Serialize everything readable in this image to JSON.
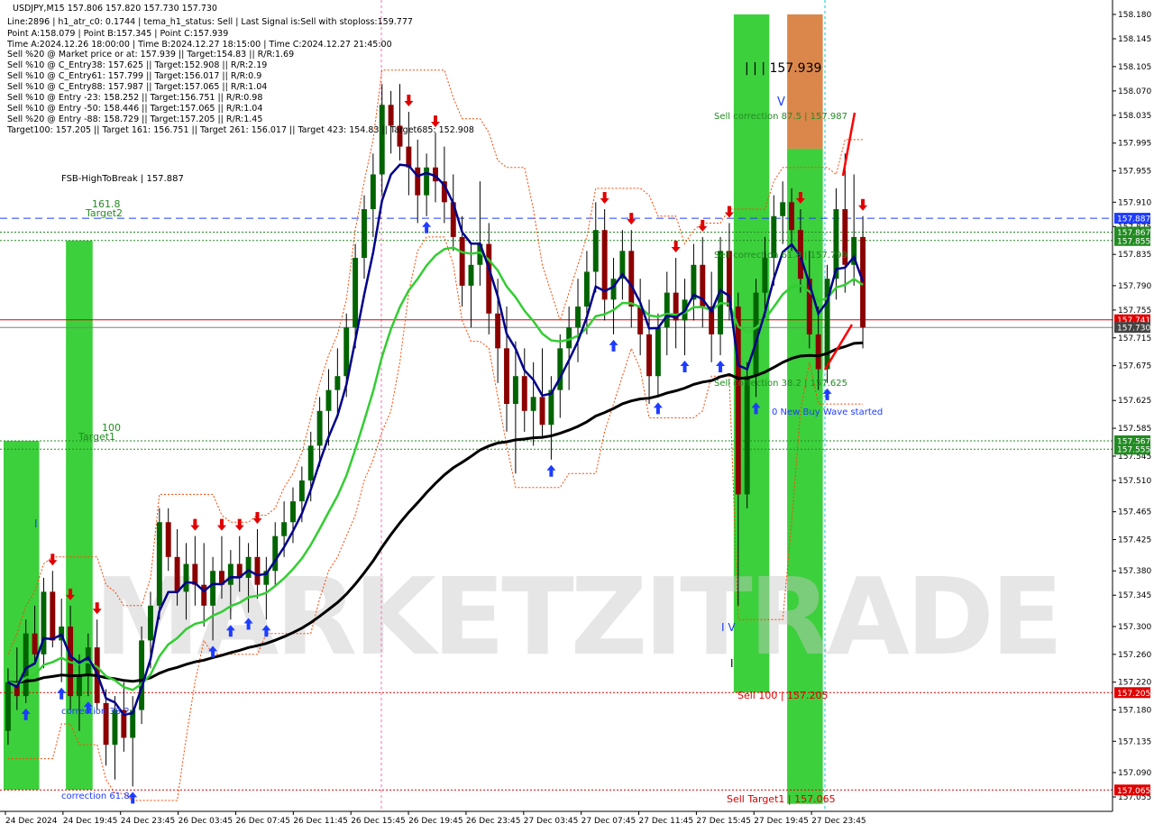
{
  "symbol_header": "USDJPY,M15  157.806 157.820 157.730 157.730",
  "info_lines": [
    "Line:2896  |  h1_atr_c0: 0.1744  |  tema_h1_status: Sell  |  Last Signal is:Sell with stoploss:159.777",
    "Point A:158.079  |  Point B:157.345  |  Point C:157.939",
    "Time A:2024.12.26 18:00:00  |  Time B:2024.12.27 18:15:00  |  Time C:2024.12.27 21:45:00",
    "Sell %20 @ Market price or at: 157.939  ||  Target:154.83  ||  R/R:1.69",
    "Sell %10 @ C_Entry38: 157.625  ||  Target:152.908  ||  R/R:2.19",
    "Sell %10 @ C_Entry61: 157.799  ||  Target:156.017  ||  R/R:0.9",
    "Sell %10 @ C_Entry88: 157.987  ||  Target:157.065  ||  R/R:1.04",
    "Sell %10 @ Entry -23: 158.252  ||  Target:156.751  ||  R/R:0.98",
    "Sell %10 @ Entry -50: 158.446  ||  Target:157.065  ||  R/R:1.04",
    "Sell %20 @ Entry -88: 158.729  ||  Target:157.205  ||  R/R:1.45",
    "Target100: 157.205  ||  Target 161: 156.751  ||  Target 261: 156.017  ||  Target 423: 154.83  ||  Target685: 152.908"
  ],
  "watermark": "MARKETZITRADE",
  "chart_labels": {
    "fsb": "FSB-HighToBreak  |  157.887",
    "target2": "Target2",
    "t161": "161.8",
    "target1": "Target1",
    "t100": "100",
    "corr382": "correction 38.2",
    "corr618": "correction 61.8",
    "point_c": "| | | 157.939",
    "sell_corr875": "Sell correction 87.5 | 157.987",
    "sell_corr618": "Sell correction 61.8 | 157.799",
    "sell_corr382": "Sell correction 38.2 | 157.625",
    "new_buy_wave": "0 New Buy Wave started",
    "sell100": "Sell 100 | 157.205",
    "sell_target1": "Sell Target1 | 157.065",
    "mark_v": "V",
    "mark_i": "I",
    "mark_iv": "I V"
  },
  "colors": {
    "bull_candle": "#006400",
    "bear_candle": "#8b0000",
    "wick": "#000000",
    "tema_line": "#00008b",
    "ema_green": "#32cd32",
    "ema_black": "#000000",
    "band_red": "#ff4500",
    "green_zone": "#32cd32",
    "orange_zone": "#d2691e",
    "fsb_line": "#1e3cff",
    "red_level": "#e00000",
    "green_level": "#228b22",
    "gray_level": "#808080"
  },
  "chart_data": {
    "type": "candlestick",
    "symbol": "USDJPY",
    "timeframe": "M15",
    "ylim": [
      157.045,
      158.185
    ],
    "y_ticks": [
      158.18,
      158.145,
      158.105,
      158.07,
      158.035,
      157.995,
      157.955,
      157.91,
      157.875,
      157.835,
      157.79,
      157.755,
      157.715,
      157.675,
      157.625,
      157.585,
      157.545,
      157.51,
      157.465,
      157.425,
      157.38,
      157.345,
      157.3,
      157.26,
      157.22,
      157.18,
      157.135,
      157.09,
      157.055
    ],
    "x_ticks": [
      "24 Dec 2024",
      "24 Dec 19:45",
      "24 Dec 23:45",
      "26 Dec 03:45",
      "26 Dec 07:45",
      "26 Dec 11:45",
      "26 Dec 15:45",
      "26 Dec 19:45",
      "26 Dec 23:45",
      "27 Dec 03:45",
      "27 Dec 07:45",
      "27 Dec 11:45",
      "27 Dec 15:45",
      "27 Dec 19:45",
      "27 Dec 23:45"
    ],
    "price_tags": [
      {
        "value": "157.887",
        "price": 157.887,
        "bg": "#1e3cff"
      },
      {
        "value": "157.867",
        "price": 157.867,
        "bg": "#228b22"
      },
      {
        "value": "157.855",
        "price": 157.855,
        "bg": "#228b22"
      },
      {
        "value": "157.741",
        "price": 157.741,
        "bg": "#e00000"
      },
      {
        "value": "157.730",
        "price": 157.73,
        "bg": "#444444"
      },
      {
        "value": "157.567",
        "price": 157.567,
        "bg": "#228b22"
      },
      {
        "value": "157.555",
        "price": 157.555,
        "bg": "#228b22"
      },
      {
        "value": "157.205",
        "price": 157.205,
        "bg": "#e00000"
      },
      {
        "value": "157.065",
        "price": 157.065,
        "bg": "#e00000"
      }
    ],
    "levels": [
      {
        "price": 157.887,
        "kind": "fsb"
      },
      {
        "price": 157.867,
        "kind": "green"
      },
      {
        "price": 157.855,
        "kind": "green"
      },
      {
        "price": 157.741,
        "kind": "red_solid"
      },
      {
        "price": 157.73,
        "kind": "gray"
      },
      {
        "price": 157.567,
        "kind": "green"
      },
      {
        "price": 157.555,
        "kind": "green"
      },
      {
        "price": 157.205,
        "kind": "red_dot"
      },
      {
        "price": 157.065,
        "kind": "red_dot"
      }
    ],
    "zones": [
      {
        "name": "Target1 zone A",
        "color": "green",
        "from": 157.567,
        "to": 157.065,
        "x0": 0,
        "x1": 4
      },
      {
        "name": "Target2 zone",
        "color": "green",
        "from": 157.855,
        "to": 157.065,
        "x0": 7,
        "x1": 10
      },
      {
        "name": "Sell zone main",
        "color": "green",
        "from": 158.18,
        "to": 157.205,
        "x0": 82,
        "x1": 86
      },
      {
        "name": "Sell Target zone",
        "color": "green",
        "from": 157.987,
        "to": 157.045,
        "x0": 88,
        "x1": 92
      },
      {
        "name": "Point C zone",
        "color": "orange",
        "from": 158.18,
        "to": 157.987,
        "x0": 88,
        "x1": 92
      }
    ],
    "candles": [
      [
        157.15,
        157.24,
        157.13,
        157.22
      ],
      [
        157.22,
        157.27,
        157.18,
        157.2
      ],
      [
        157.2,
        157.31,
        157.19,
        157.29
      ],
      [
        157.29,
        157.33,
        157.25,
        157.26
      ],
      [
        157.26,
        157.37,
        157.24,
        157.35
      ],
      [
        157.35,
        157.38,
        157.27,
        157.28
      ],
      [
        157.28,
        157.34,
        157.22,
        157.3
      ],
      [
        157.3,
        157.33,
        157.18,
        157.2
      ],
      [
        157.2,
        157.26,
        157.15,
        157.23
      ],
      [
        157.23,
        157.29,
        157.2,
        157.27
      ],
      [
        157.27,
        157.31,
        157.18,
        157.19
      ],
      [
        157.19,
        157.21,
        157.1,
        157.13
      ],
      [
        157.13,
        157.2,
        157.08,
        157.18
      ],
      [
        157.18,
        157.22,
        157.12,
        157.14
      ],
      [
        157.14,
        157.2,
        157.07,
        157.18
      ],
      [
        157.18,
        157.3,
        157.16,
        157.28
      ],
      [
        157.28,
        157.35,
        157.24,
        157.33
      ],
      [
        157.33,
        157.47,
        157.31,
        157.45
      ],
      [
        157.45,
        157.47,
        157.38,
        157.4
      ],
      [
        157.4,
        157.44,
        157.33,
        157.35
      ],
      [
        157.35,
        157.42,
        157.31,
        157.39
      ],
      [
        157.39,
        157.43,
        157.33,
        157.36
      ],
      [
        157.36,
        157.42,
        157.3,
        157.33
      ],
      [
        157.33,
        157.4,
        157.28,
        157.38
      ],
      [
        157.38,
        157.43,
        157.34,
        157.36
      ],
      [
        157.36,
        157.41,
        157.31,
        157.39
      ],
      [
        157.39,
        157.43,
        157.35,
        157.37
      ],
      [
        157.37,
        157.42,
        157.32,
        157.4
      ],
      [
        157.4,
        157.44,
        157.34,
        157.36
      ],
      [
        157.36,
        157.4,
        157.31,
        157.38
      ],
      [
        157.38,
        157.45,
        157.36,
        157.43
      ],
      [
        157.43,
        157.48,
        157.4,
        157.45
      ],
      [
        157.45,
        157.5,
        157.42,
        157.48
      ],
      [
        157.48,
        157.53,
        157.45,
        157.51
      ],
      [
        157.51,
        157.58,
        157.48,
        157.56
      ],
      [
        157.56,
        157.63,
        157.53,
        157.61
      ],
      [
        157.61,
        157.67,
        157.56,
        157.64
      ],
      [
        157.64,
        157.7,
        157.6,
        157.66
      ],
      [
        157.66,
        157.75,
        157.63,
        157.73
      ],
      [
        157.73,
        157.85,
        157.7,
        157.83
      ],
      [
        157.83,
        157.92,
        157.8,
        157.9
      ],
      [
        157.9,
        157.98,
        157.86,
        157.95
      ],
      [
        157.95,
        158.08,
        157.92,
        158.05
      ],
      [
        158.05,
        158.07,
        157.98,
        158.02
      ],
      [
        158.02,
        158.08,
        157.97,
        157.99
      ],
      [
        157.99,
        158.04,
        157.92,
        157.96
      ],
      [
        157.96,
        158.0,
        157.88,
        157.92
      ],
      [
        157.92,
        157.98,
        157.89,
        157.96
      ],
      [
        157.96,
        158.01,
        157.91,
        157.94
      ],
      [
        157.94,
        157.99,
        157.88,
        157.91
      ],
      [
        157.91,
        157.95,
        157.84,
        157.86
      ],
      [
        157.86,
        157.89,
        157.76,
        157.79
      ],
      [
        157.79,
        157.85,
        157.73,
        157.82
      ],
      [
        157.82,
        157.94,
        157.79,
        157.85
      ],
      [
        157.85,
        157.88,
        157.72,
        157.75
      ],
      [
        157.75,
        157.8,
        157.65,
        157.7
      ],
      [
        157.7,
        157.76,
        157.58,
        157.62
      ],
      [
        157.62,
        157.71,
        157.52,
        157.66
      ],
      [
        157.66,
        157.7,
        157.58,
        157.61
      ],
      [
        157.61,
        157.68,
        157.56,
        157.63
      ],
      [
        157.63,
        157.7,
        157.57,
        157.59
      ],
      [
        157.59,
        157.66,
        157.54,
        157.64
      ],
      [
        157.64,
        157.72,
        157.6,
        157.7
      ],
      [
        157.7,
        157.76,
        157.64,
        157.73
      ],
      [
        157.73,
        157.8,
        157.68,
        157.76
      ],
      [
        157.76,
        157.84,
        157.72,
        157.81
      ],
      [
        157.81,
        157.91,
        157.78,
        157.87
      ],
      [
        157.87,
        157.9,
        157.74,
        157.77
      ],
      [
        157.77,
        157.83,
        157.72,
        157.8
      ],
      [
        157.8,
        157.87,
        157.77,
        157.84
      ],
      [
        157.84,
        157.87,
        157.73,
        157.76
      ],
      [
        157.76,
        157.8,
        157.69,
        157.72
      ],
      [
        157.72,
        157.77,
        157.62,
        157.66
      ],
      [
        157.66,
        157.75,
        157.63,
        157.73
      ],
      [
        157.73,
        157.81,
        157.69,
        157.78
      ],
      [
        157.78,
        157.83,
        157.7,
        157.74
      ],
      [
        157.74,
        157.8,
        157.69,
        157.77
      ],
      [
        157.77,
        157.85,
        157.74,
        157.82
      ],
      [
        157.82,
        157.86,
        157.73,
        157.76
      ],
      [
        157.76,
        157.81,
        157.68,
        157.72
      ],
      [
        157.72,
        157.86,
        157.69,
        157.84
      ],
      [
        157.84,
        157.88,
        157.74,
        157.76
      ],
      [
        157.76,
        157.78,
        157.33,
        157.49
      ],
      [
        157.49,
        157.68,
        157.47,
        157.66
      ],
      [
        157.66,
        157.8,
        157.63,
        157.78
      ],
      [
        157.78,
        157.86,
        157.74,
        157.83
      ],
      [
        157.83,
        157.92,
        157.79,
        157.89
      ],
      [
        157.89,
        157.94,
        157.85,
        157.91
      ],
      [
        157.91,
        157.93,
        157.84,
        157.87
      ],
      [
        157.87,
        157.9,
        157.78,
        157.8
      ],
      [
        157.8,
        157.84,
        157.7,
        157.72
      ],
      [
        157.72,
        157.76,
        157.64,
        157.67
      ],
      [
        157.67,
        157.82,
        157.65,
        157.8
      ],
      [
        157.8,
        157.93,
        157.77,
        157.9
      ],
      [
        157.9,
        157.98,
        157.78,
        157.82
      ],
      [
        157.82,
        157.95,
        157.79,
        157.86
      ],
      [
        157.86,
        157.89,
        157.7,
        157.73
      ]
    ]
  }
}
